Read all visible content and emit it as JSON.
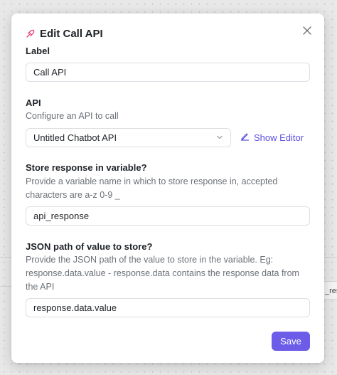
{
  "background": {
    "peek_text": "_res"
  },
  "modal": {
    "title": "Edit Call API",
    "title_icon": "link-rocket-icon",
    "close_icon": "close-icon",
    "accent_color": "#6c5ce7",
    "label_section": {
      "label": "Label",
      "value": "Call API"
    },
    "api_section": {
      "label": "API",
      "description": "Configure an API to call",
      "selected": "Untitled Chatbot API",
      "show_editor_label": "Show Editor",
      "show_editor_icon": "pencil-icon"
    },
    "store_section": {
      "label": "Store response in variable?",
      "description": "Provide a variable name in which to store response in, accepted characters are a-z 0-9 _",
      "value": "api_response"
    },
    "json_section": {
      "label": "JSON path of value to store?",
      "description": "Provide the JSON path of the value to store in the variable. Eg: response.data.value - response.data contains the response data from the API",
      "value": "response.data.value"
    },
    "save_label": "Save"
  }
}
